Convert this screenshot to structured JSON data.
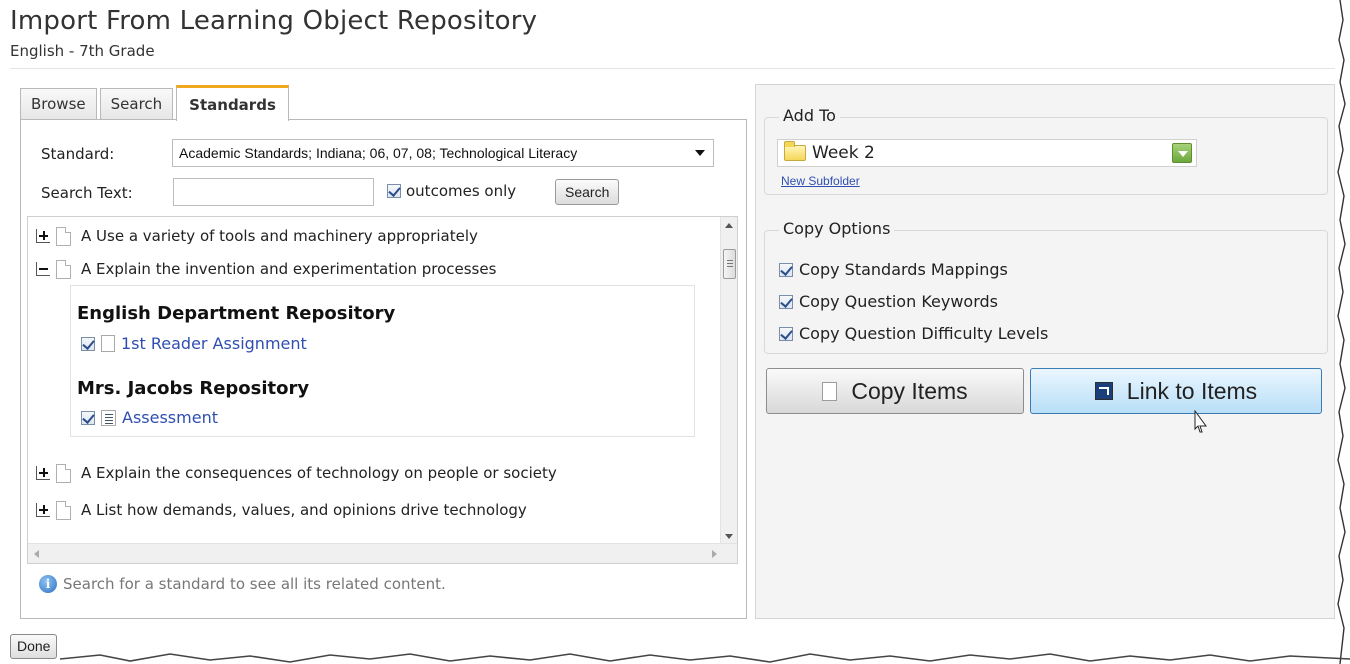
{
  "page": {
    "title": "Import From Learning Object Repository",
    "subtitle": "English - 7th Grade"
  },
  "tabs": [
    {
      "label": "Browse"
    },
    {
      "label": "Search"
    },
    {
      "label": "Standards",
      "active": true
    }
  ],
  "filters": {
    "standard_label": "Standard:",
    "standard_value": "Academic Standards; Indiana; 06, 07, 08; Technological Literacy",
    "search_text_label": "Search Text:",
    "search_text_value": "",
    "outcomes_only_label": "outcomes only",
    "outcomes_only_checked": true,
    "search_button": "Search"
  },
  "tree": {
    "items": [
      {
        "label": "A Use a variety of tools and machinery appropriately",
        "expanded": false
      },
      {
        "label": "A Explain the invention and experimentation processes",
        "expanded": true
      },
      {
        "label": "A Explain the consequences of technology on people or society",
        "expanded": false
      },
      {
        "label": "A List how demands, values, and opinions drive technology",
        "expanded": false
      }
    ],
    "repositories": [
      {
        "name": "English Department Repository",
        "item": "1st Reader Assignment",
        "icon": "document-icon",
        "checked": true
      },
      {
        "name": "Mrs. Jacobs Repository",
        "item": "Assessment",
        "icon": "assessment-icon",
        "checked": true
      }
    ]
  },
  "hint": "Search for a standard to see all its related content.",
  "done_button": "Done",
  "add_to": {
    "legend": "Add To",
    "folder": "Week 2",
    "new_subfolder": "New Subfolder"
  },
  "copy_options": {
    "legend": "Copy Options",
    "options": [
      {
        "label": "Copy Standards Mappings",
        "checked": true
      },
      {
        "label": "Copy Question Keywords",
        "checked": true
      },
      {
        "label": "Copy Question Difficulty Levels",
        "checked": true
      }
    ]
  },
  "actions": {
    "copy_items": "Copy Items",
    "link_to_items": "Link to Items"
  },
  "colors": {
    "active_tab_accent": "#f0a91d",
    "link": "#2f4fb0",
    "link_button_bg": "#b9dff7"
  }
}
